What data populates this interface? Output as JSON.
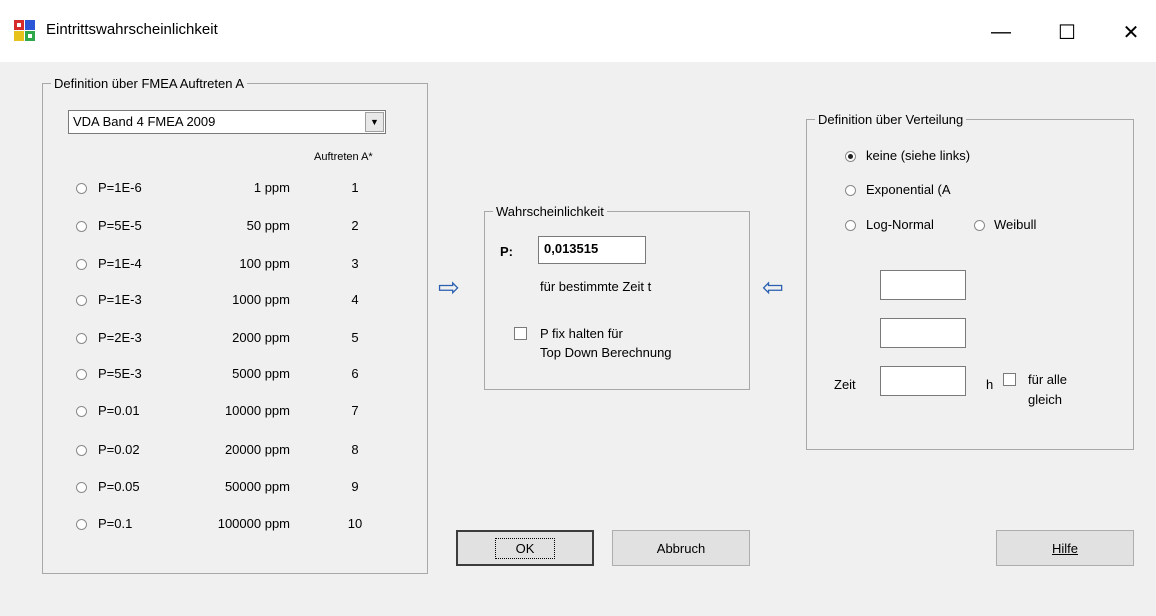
{
  "window": {
    "title": "Eintrittswahrscheinlichkeit",
    "controls": {
      "minimize": "—",
      "maximize": "☐",
      "close": "✕"
    }
  },
  "fmea": {
    "legend": "Definition über FMEA Auftreten A",
    "combo_value": "VDA Band 4 FMEA 2009",
    "column_header": "Auftreten A*",
    "rows": [
      {
        "label": "P=1E-6",
        "ppm": "1 ppm",
        "a": "1"
      },
      {
        "label": "P=5E-5",
        "ppm": "50 ppm",
        "a": "2"
      },
      {
        "label": "P=1E-4",
        "ppm": "100 ppm",
        "a": "3"
      },
      {
        "label": "P=1E-3",
        "ppm": "1000 ppm",
        "a": "4"
      },
      {
        "label": "P=2E-3",
        "ppm": "2000 ppm",
        "a": "5"
      },
      {
        "label": "P=5E-3",
        "ppm": "5000 ppm",
        "a": "6"
      },
      {
        "label": "P=0.01",
        "ppm": "10000 ppm",
        "a": "7"
      },
      {
        "label": "P=0.02",
        "ppm": "20000 ppm",
        "a": "8"
      },
      {
        "label": "P=0.05",
        "ppm": "50000 ppm",
        "a": "9"
      },
      {
        "label": "P=0.1",
        "ppm": "100000 ppm",
        "a": "10"
      }
    ]
  },
  "probability": {
    "legend": "Wahrscheinlichkeit",
    "p_label": "P:",
    "p_value": "0,013515",
    "time_note": "für bestimmte Zeit t",
    "fix_line1": "P fix halten für",
    "fix_line2": "Top Down Berechnung"
  },
  "arrows": {
    "right": "⇨",
    "left": "⇦"
  },
  "distribution": {
    "legend": "Definition über Verteilung",
    "opt_none": "keine (siehe links)",
    "opt_exp": "Exponential (A",
    "opt_lognormal": "Log-Normal",
    "opt_weibull": "Weibull",
    "field1": "",
    "field2": "",
    "zeit_label": "Zeit",
    "zeit_value": "",
    "unit_h": "h",
    "all_line1": "für alle",
    "all_line2": "gleich"
  },
  "buttons": {
    "ok": "OK",
    "cancel": "Abbruch",
    "help": "Hilfe"
  }
}
